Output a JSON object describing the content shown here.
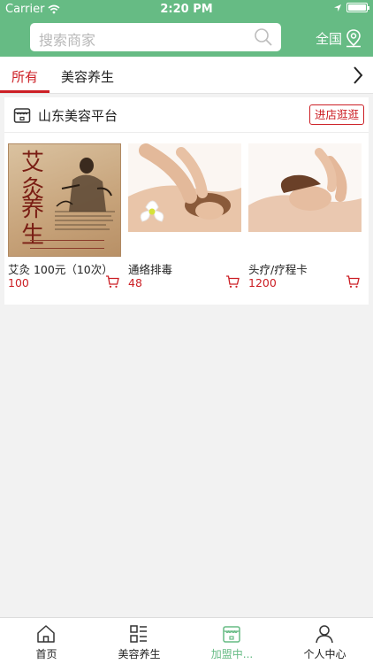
{
  "status_bar": {
    "carrier": "Carrier",
    "time": "2:20 PM"
  },
  "header": {
    "search_placeholder": "搜索商家",
    "region_label": "全国"
  },
  "tabs": [
    {
      "label": "所有",
      "active": true
    },
    {
      "label": "美容养生",
      "active": false
    }
  ],
  "store": {
    "name": "山东美容平台",
    "enter_label": "进店逛逛",
    "products": [
      {
        "name": "艾灸 100元（10次）",
        "price": "100",
        "image": "moxibustion-painting"
      },
      {
        "name": "通络排毒",
        "price": "48",
        "image": "back-massage-photo"
      },
      {
        "name": "头疗/疗程卡",
        "price": "1200",
        "image": "head-therapy-photo"
      }
    ]
  },
  "painting": {
    "line1": "艾灸",
    "line2": "养生"
  },
  "bottom_nav": [
    {
      "label": "首页",
      "icon": "home-icon",
      "active": false
    },
    {
      "label": "美容养生",
      "icon": "list-icon",
      "active": false
    },
    {
      "label": "加盟中...",
      "icon": "store-icon",
      "active": true
    },
    {
      "label": "个人中心",
      "icon": "user-icon",
      "active": false
    }
  ],
  "colors": {
    "brand_green": "#66bb84",
    "accent_red": "#cc1f25"
  }
}
